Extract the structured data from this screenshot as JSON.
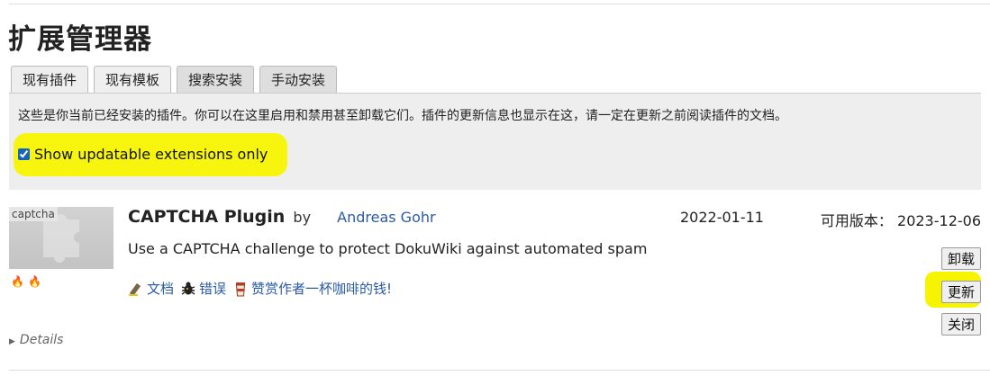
{
  "page": {
    "title": "扩展管理器"
  },
  "tabs": [
    {
      "label": "现有插件",
      "active": true
    },
    {
      "label": "现有模板",
      "active": false
    },
    {
      "label": "搜索安装",
      "active": false
    },
    {
      "label": "手动安装",
      "active": false
    }
  ],
  "panel": {
    "intro": "这些是你当前已经安装的插件。你可以在这里启用和禁用甚至卸载它们。插件的更新信息也显示在这，请一定在更新之前阅读插件的文档。",
    "filter_label": "Show updatable extensions only",
    "filter_checked": true,
    "highlight_color": "#f7f400"
  },
  "extension": {
    "screenshot_label": "captcha",
    "name": "CAPTCHA Plugin",
    "by": "by",
    "author": "Andreas Gohr",
    "installed_date": "2022-01-11",
    "available_label": "可用版本：",
    "available_date": "2023-12-06",
    "description": "Use a CAPTCHA challenge to protect DokuWiki against automated spam",
    "links": {
      "docs": "文档",
      "bugs": "错误",
      "donate": "赞赏作者一杯咖啡的钱!"
    },
    "buttons": {
      "uninstall": "卸载",
      "update": "更新",
      "disable": "关闭"
    },
    "details": "Details"
  }
}
